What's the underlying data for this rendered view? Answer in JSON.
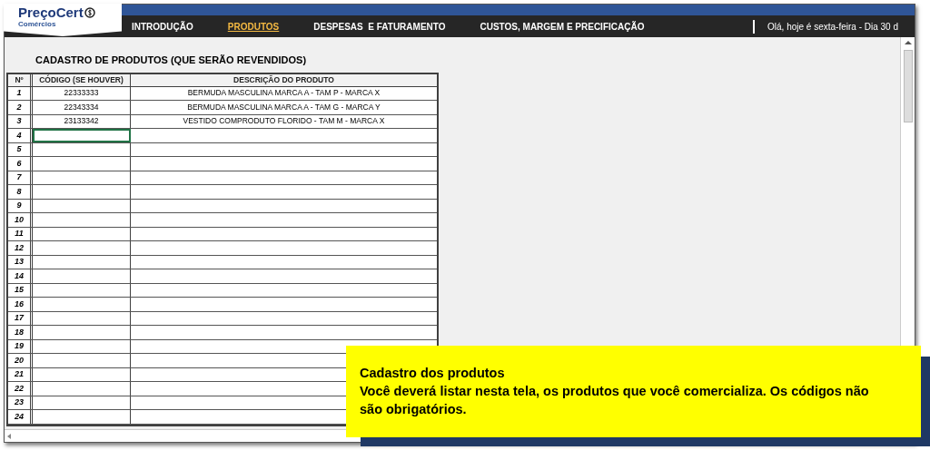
{
  "logo": {
    "name": "PreçoCert",
    "subtitle": "Comércios"
  },
  "nav": [
    {
      "label": "INTRODUÇÃO",
      "selected": false
    },
    {
      "label": "PRODUTOS",
      "selected": true
    },
    {
      "label": "DESPESAS  E FATURAMENTO",
      "selected": false
    },
    {
      "label": "CUSTOS, MARGEM E PRECIFICAÇÃO",
      "selected": false
    }
  ],
  "greeting": "Olá, hoje é sexta-feira - Dia 30 d",
  "sheet_title": "CADASTRO DE PRODUTOS (QUE SERÃO REVENDIDOS)",
  "table": {
    "columns": [
      "Nº",
      "CÓDIGO (SE HOUVER)",
      "DESCRIÇÃO DO PRODUTO"
    ],
    "rows": [
      {
        "number": "1",
        "code": "22333333",
        "description": "BERMUDA MASCULINA MARCA A - TAM P - MARCA X",
        "selected": false
      },
      {
        "number": "2",
        "code": "22343334",
        "description": "BERMUDA MASCULINA MARCA A - TAM G - MARCA Y",
        "selected": false
      },
      {
        "number": "3",
        "code": "23133342",
        "description": "VESTIDO COMPRODUTO FLORIDO - TAM M - MARCA X",
        "selected": false
      },
      {
        "number": "4",
        "selected": true
      },
      {
        "number": "5",
        "selected": false
      },
      {
        "number": "6",
        "selected": false
      },
      {
        "number": "7",
        "selected": false
      },
      {
        "number": "8",
        "selected": false
      },
      {
        "number": "9",
        "selected": false
      },
      {
        "number": "10",
        "selected": false
      },
      {
        "number": "11",
        "selected": false
      },
      {
        "number": "12",
        "selected": false
      },
      {
        "number": "13",
        "selected": false
      },
      {
        "number": "14",
        "selected": false
      },
      {
        "number": "15",
        "selected": false
      },
      {
        "number": "16",
        "selected": false
      },
      {
        "number": "17",
        "selected": false
      },
      {
        "number": "18",
        "selected": false
      },
      {
        "number": "19",
        "selected": false
      },
      {
        "number": "20",
        "selected": false
      },
      {
        "number": "21",
        "selected": false
      },
      {
        "number": "22",
        "selected": false
      },
      {
        "number": "23",
        "selected": false
      },
      {
        "number": "24",
        "selected": false
      }
    ]
  },
  "callout": {
    "title": "Cadastro dos produtos",
    "text": "Você deverá listar nesta tela, os produtos que você comercializa. Os códigos não são obrigatórios."
  }
}
